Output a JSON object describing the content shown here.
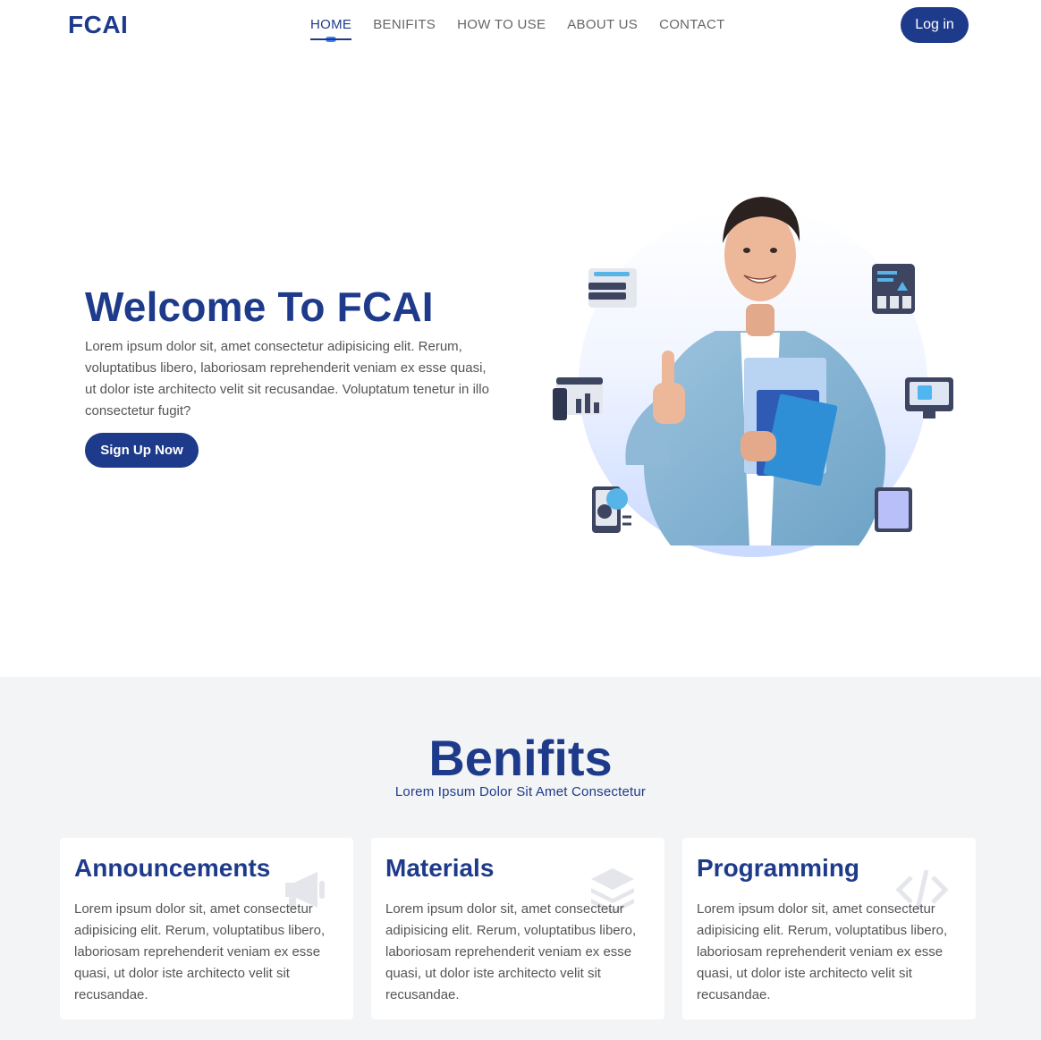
{
  "brand": {
    "logo": "FCAI"
  },
  "nav": {
    "items": [
      {
        "label": "HOME",
        "active": true
      },
      {
        "label": "BENIFITS",
        "active": false
      },
      {
        "label": "HOW TO USE",
        "active": false
      },
      {
        "label": "ABOUT US",
        "active": false
      },
      {
        "label": "CONTACT",
        "active": false
      }
    ],
    "login_label": "Log in"
  },
  "hero": {
    "title": "Welcome To FCAI",
    "text": "Lorem ipsum dolor sit, amet consectetur adipisicing elit. Rerum, voluptatibus libero, laboriosam reprehenderit veniam ex esse quasi, ut dolor iste architecto velit sit recusandae. Voluptatum tenetur in illo consectetur fugit?",
    "cta_label": "Sign Up Now",
    "image": "student-thumbs-up-illustration"
  },
  "benefits": {
    "title": "Benifits",
    "subtitle": "Lorem Ipsum Dolor Sit Amet Consectetur",
    "cards": [
      {
        "title": "Announcements",
        "icon": "megaphone-icon",
        "text": "Lorem ipsum dolor sit, amet consectetur adipisicing elit. Rerum, voluptatibus libero, laboriosam reprehenderit veniam ex esse quasi, ut dolor iste architecto velit sit recusandae."
      },
      {
        "title": "Materials",
        "icon": "layers-icon",
        "text": "Lorem ipsum dolor sit, amet consectetur adipisicing elit. Rerum, voluptatibus libero, laboriosam reprehenderit veniam ex esse quasi, ut dolor iste architecto velit sit recusandae."
      },
      {
        "title": "Programming",
        "icon": "code-icon",
        "text": "Lorem ipsum dolor sit, amet consectetur adipisicing elit. Rerum, voluptatibus libero, laboriosam reprehenderit veniam ex esse quasi, ut dolor iste architecto velit sit recusandae."
      }
    ]
  },
  "colors": {
    "primary": "#1e3a8a",
    "accent": "#3b82f6",
    "section_bg": "#f3f4f6"
  }
}
